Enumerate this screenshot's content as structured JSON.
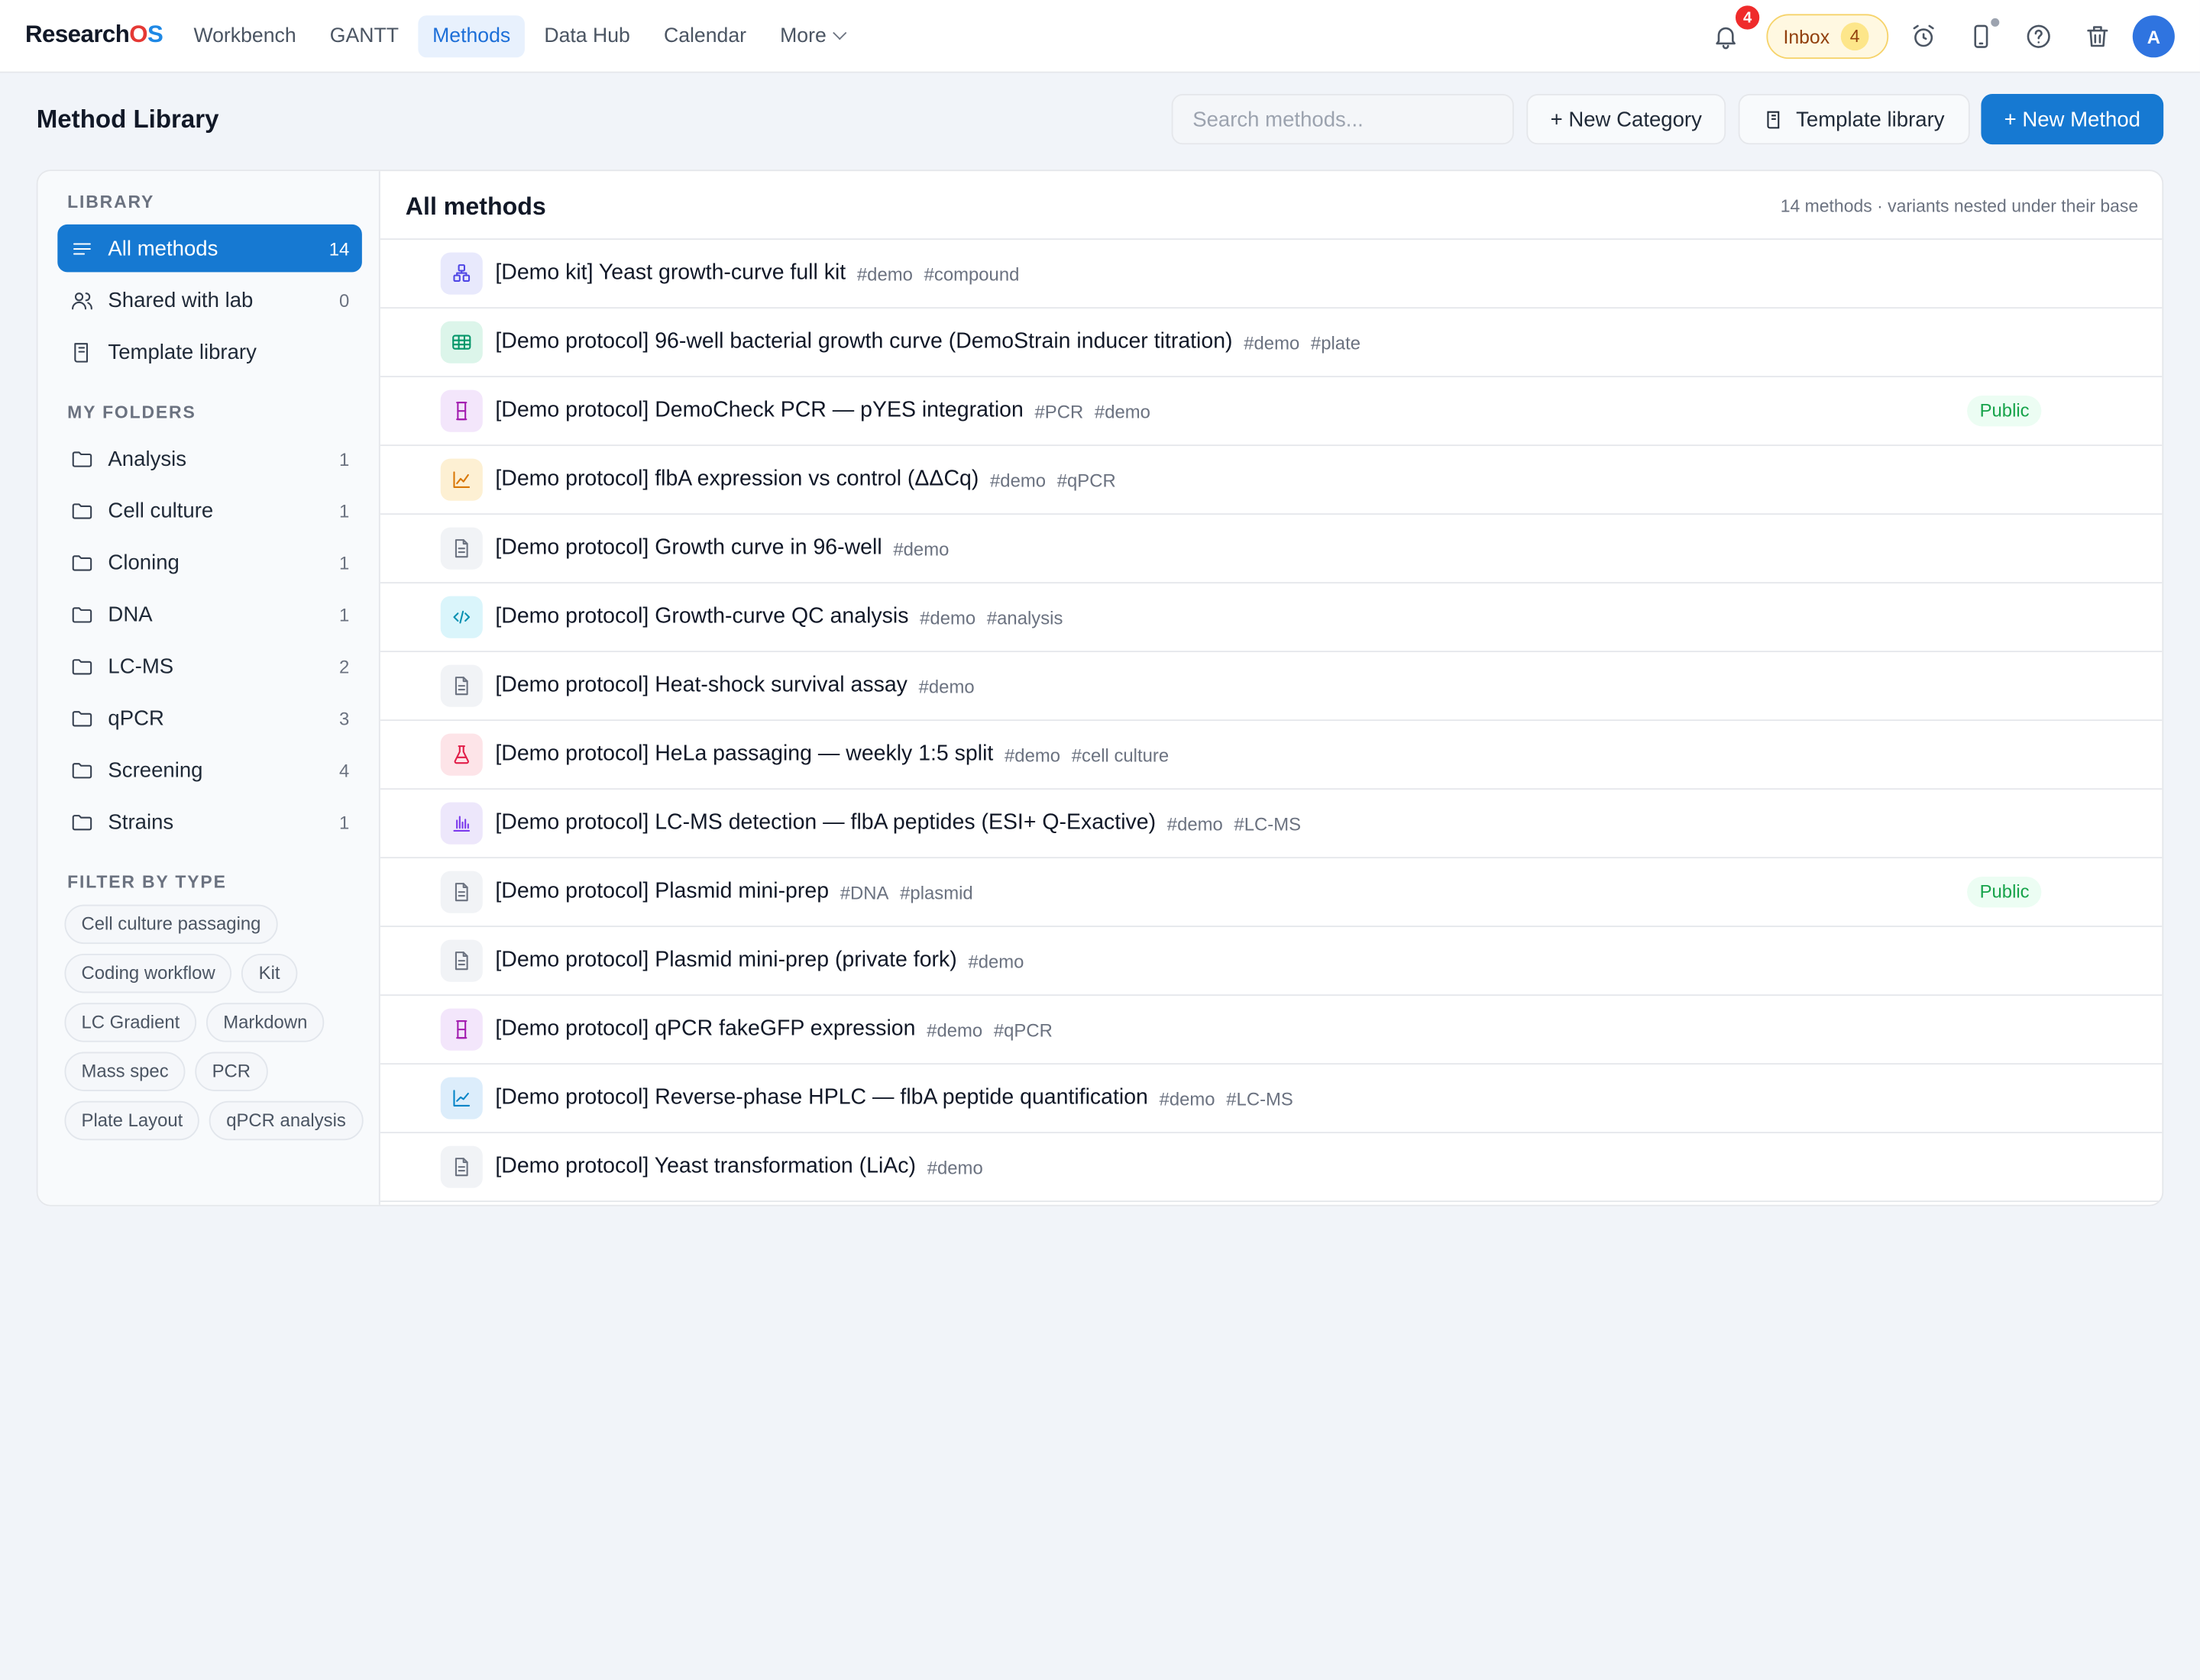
{
  "app": {
    "brand_prefix": "Research",
    "brand_o": "O",
    "brand_s": "S",
    "nav": [
      "Workbench",
      "GANTT",
      "Methods",
      "Data Hub",
      "Calendar"
    ],
    "nav_more": "More",
    "notification_count": "4",
    "inbox_label": "Inbox",
    "inbox_count": "4",
    "avatar_initial": "A"
  },
  "header": {
    "title": "Method Library",
    "search_placeholder": "Search methods...",
    "new_category": "+ New Category",
    "template_library": "Template library",
    "new_method": "+ New Method"
  },
  "sidebar": {
    "library_label": "LIBRARY",
    "library": [
      {
        "label": "All methods",
        "count": "14",
        "icon": "list-icon"
      },
      {
        "label": "Shared with lab",
        "count": "0",
        "icon": "users-icon"
      },
      {
        "label": "Template library",
        "count": "",
        "icon": "book-icon"
      }
    ],
    "folders_label": "MY FOLDERS",
    "folders": [
      {
        "label": "Analysis",
        "count": "1"
      },
      {
        "label": "Cell culture",
        "count": "1"
      },
      {
        "label": "Cloning",
        "count": "1"
      },
      {
        "label": "DNA",
        "count": "1"
      },
      {
        "label": "LC-MS",
        "count": "2"
      },
      {
        "label": "qPCR",
        "count": "3"
      },
      {
        "label": "Screening",
        "count": "4"
      },
      {
        "label": "Strains",
        "count": "1"
      }
    ],
    "filter_label": "FILTER BY TYPE",
    "filters": [
      "Cell culture passaging",
      "Coding workflow",
      "Kit",
      "LC Gradient",
      "Markdown",
      "Mass spec",
      "PCR",
      "Plate Layout",
      "qPCR analysis"
    ]
  },
  "content": {
    "title": "All methods",
    "meta": "14 methods · variants nested under their base",
    "public_label": "Public",
    "methods": [
      {
        "title": "[Demo kit] Yeast growth-curve full kit",
        "tags": [
          "#demo",
          "#compound"
        ],
        "icon": "kit-icon",
        "public": false
      },
      {
        "title": "[Demo protocol] 96-well bacterial growth curve (DemoStrain inducer titration)",
        "tags": [
          "#demo",
          "#plate"
        ],
        "icon": "plate-icon",
        "public": false
      },
      {
        "title": "[Demo protocol] DemoCheck PCR — pYES integration",
        "tags": [
          "#PCR",
          "#demo"
        ],
        "icon": "pcr-icon",
        "public": true
      },
      {
        "title": "[Demo protocol] flbA expression vs control (ΔΔCq)",
        "tags": [
          "#demo",
          "#qPCR"
        ],
        "icon": "qpcr-analysis-icon",
        "public": false
      },
      {
        "title": "[Demo protocol] Growth curve in 96-well",
        "tags": [
          "#demo"
        ],
        "icon": "document-icon",
        "public": false
      },
      {
        "title": "[Demo protocol] Growth-curve QC analysis",
        "tags": [
          "#demo",
          "#analysis"
        ],
        "icon": "code-icon",
        "public": false
      },
      {
        "title": "[Demo protocol] Heat-shock survival assay",
        "tags": [
          "#demo"
        ],
        "icon": "document-icon",
        "public": false
      },
      {
        "title": "[Demo protocol] HeLa passaging — weekly 1:5 split",
        "tags": [
          "#demo",
          "#cell culture"
        ],
        "icon": "flask-icon",
        "public": false
      },
      {
        "title": "[Demo protocol] LC-MS detection — flbA peptides (ESI+ Q-Exactive)",
        "tags": [
          "#demo",
          "#LC-MS"
        ],
        "icon": "mass-spec-icon",
        "public": false
      },
      {
        "title": "[Demo protocol] Plasmid mini-prep",
        "tags": [
          "#DNA",
          "#plasmid"
        ],
        "icon": "document-icon",
        "public": true
      },
      {
        "title": "[Demo protocol] Plasmid mini-prep (private fork)",
        "tags": [
          "#demo"
        ],
        "icon": "document-icon",
        "public": false
      },
      {
        "title": "[Demo protocol] qPCR fakeGFP expression",
        "tags": [
          "#demo",
          "#qPCR"
        ],
        "icon": "pcr-icon",
        "public": false
      },
      {
        "title": "[Demo protocol] Reverse-phase HPLC — flbA peptide quantification",
        "tags": [
          "#demo",
          "#LC-MS"
        ],
        "icon": "lc-gradient-icon",
        "public": false
      },
      {
        "title": "[Demo protocol] Yeast transformation (LiAc)",
        "tags": [
          "#demo"
        ],
        "icon": "document-icon",
        "public": false
      }
    ]
  },
  "colors": {
    "primary": "#1679d2",
    "badge_red": "#ef2b2b",
    "public_green": "#16a34a",
    "inbox_amber": "#fde68a"
  }
}
